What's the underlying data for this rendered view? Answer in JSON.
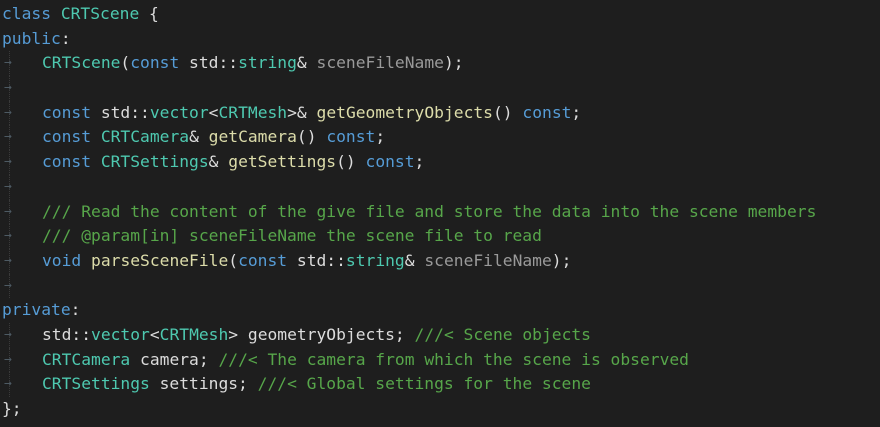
{
  "colors": {
    "background": "#1e1e1e",
    "keyword": "#569cd6",
    "type": "#4ec9b0",
    "function": "#dcdcaa",
    "comment": "#57a64a",
    "parameter": "#9a9a9a",
    "text": "#dcdcdc"
  },
  "indent_marker": "→",
  "lines": [
    {
      "indent": false,
      "tokens": [
        [
          "kw",
          "class"
        ],
        [
          "tx",
          " "
        ],
        [
          "ty",
          "CRTScene"
        ],
        [
          "tx",
          " {"
        ]
      ]
    },
    {
      "indent": false,
      "tokens": [
        [
          "kw",
          "public"
        ],
        [
          "tx",
          ":"
        ]
      ]
    },
    {
      "indent": true,
      "tokens": [
        [
          "ty",
          "CRTScene"
        ],
        [
          "tx",
          "("
        ],
        [
          "kw",
          "const"
        ],
        [
          "tx",
          " std::"
        ],
        [
          "ty",
          "string"
        ],
        [
          "tx",
          "& "
        ],
        [
          "pr",
          "sceneFileName"
        ],
        [
          "tx",
          ");"
        ]
      ]
    },
    {
      "indent": true,
      "tokens": []
    },
    {
      "indent": true,
      "tokens": [
        [
          "kw",
          "const"
        ],
        [
          "tx",
          " std::"
        ],
        [
          "ty",
          "vector"
        ],
        [
          "tx",
          "<"
        ],
        [
          "ty",
          "CRTMesh"
        ],
        [
          "tx",
          ">& "
        ],
        [
          "fn",
          "getGeometryObjects"
        ],
        [
          "tx",
          "() "
        ],
        [
          "kw",
          "const"
        ],
        [
          "tx",
          ";"
        ]
      ]
    },
    {
      "indent": true,
      "tokens": [
        [
          "kw",
          "const"
        ],
        [
          "tx",
          " "
        ],
        [
          "ty",
          "CRTCamera"
        ],
        [
          "tx",
          "& "
        ],
        [
          "fn",
          "getCamera"
        ],
        [
          "tx",
          "() "
        ],
        [
          "kw",
          "const"
        ],
        [
          "tx",
          ";"
        ]
      ]
    },
    {
      "indent": true,
      "tokens": [
        [
          "kw",
          "const"
        ],
        [
          "tx",
          " "
        ],
        [
          "ty",
          "CRTSettings"
        ],
        [
          "tx",
          "& "
        ],
        [
          "fn",
          "getSettings"
        ],
        [
          "tx",
          "() "
        ],
        [
          "kw",
          "const"
        ],
        [
          "tx",
          ";"
        ]
      ]
    },
    {
      "indent": true,
      "tokens": []
    },
    {
      "indent": true,
      "tokens": [
        [
          "cm",
          "/// Read the content of the give file and store the data into the scene members"
        ]
      ]
    },
    {
      "indent": true,
      "tokens": [
        [
          "cm",
          "/// @param[in] sceneFileName the scene file to read"
        ]
      ]
    },
    {
      "indent": true,
      "tokens": [
        [
          "kw",
          "void"
        ],
        [
          "tx",
          " "
        ],
        [
          "fn",
          "parseSceneFile"
        ],
        [
          "tx",
          "("
        ],
        [
          "kw",
          "const"
        ],
        [
          "tx",
          " std::"
        ],
        [
          "ty",
          "string"
        ],
        [
          "tx",
          "& "
        ],
        [
          "pr",
          "sceneFileName"
        ],
        [
          "tx",
          ");"
        ]
      ]
    },
    {
      "indent": true,
      "tokens": []
    },
    {
      "indent": false,
      "tokens": [
        [
          "kw",
          "private"
        ],
        [
          "tx",
          ":"
        ]
      ]
    },
    {
      "indent": true,
      "tokens": [
        [
          "tx",
          "std::"
        ],
        [
          "ty",
          "vector"
        ],
        [
          "tx",
          "<"
        ],
        [
          "ty",
          "CRTMesh"
        ],
        [
          "tx",
          "> geometryObjects; "
        ],
        [
          "cm",
          "///< Scene objects"
        ]
      ]
    },
    {
      "indent": true,
      "tokens": [
        [
          "ty",
          "CRTCamera"
        ],
        [
          "tx",
          " camera; "
        ],
        [
          "cm",
          "///< The camera from which the scene is observed"
        ]
      ]
    },
    {
      "indent": true,
      "tokens": [
        [
          "ty",
          "CRTSettings"
        ],
        [
          "tx",
          " settings; "
        ],
        [
          "cm",
          "///< Global settings for the scene"
        ]
      ]
    },
    {
      "indent": false,
      "tokens": [
        [
          "tx",
          "};"
        ]
      ]
    }
  ]
}
